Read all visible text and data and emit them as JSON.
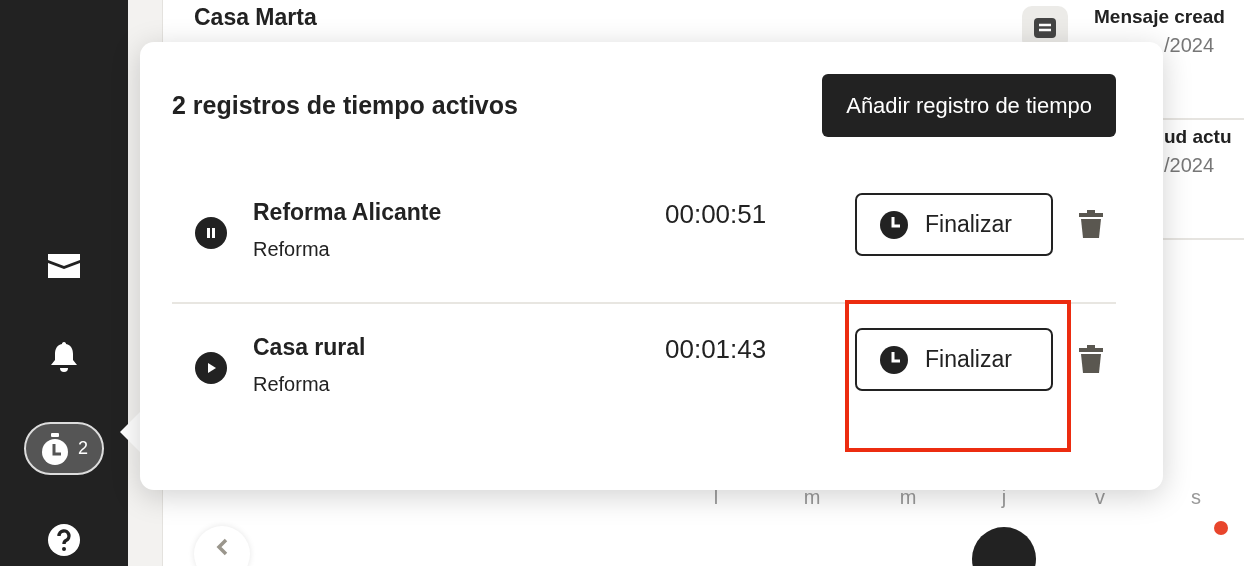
{
  "sidebar": {
    "items": [
      {
        "kind": "mail"
      },
      {
        "kind": "bell"
      },
      {
        "kind": "timer",
        "badge": "2",
        "selected": true
      },
      {
        "kind": "help"
      }
    ]
  },
  "background": {
    "title": "Casa Marta",
    "activity": [
      {
        "title": "Mensaje cread",
        "date": "/2024"
      },
      {
        "title": "ud actu",
        "date": "/2024"
      }
    ],
    "calendar": {
      "weekdays": [
        "l",
        "m",
        "m",
        "j",
        "v",
        "s"
      ],
      "today_marker": true,
      "event_dot": true
    }
  },
  "popup": {
    "title": "2 registros de tiempo activos",
    "add_button": "Añadir registro de tiempo",
    "entries": [
      {
        "name": "Reforma Alicante",
        "category": "Reforma",
        "time": "00:00:51",
        "running": true,
        "finish_button": "Finalizar",
        "highlighted": false
      },
      {
        "name": "Casa rural",
        "category": "Reforma",
        "time": "00:01:43",
        "running": false,
        "finish_button": "Finalizar",
        "highlighted": true
      }
    ]
  }
}
